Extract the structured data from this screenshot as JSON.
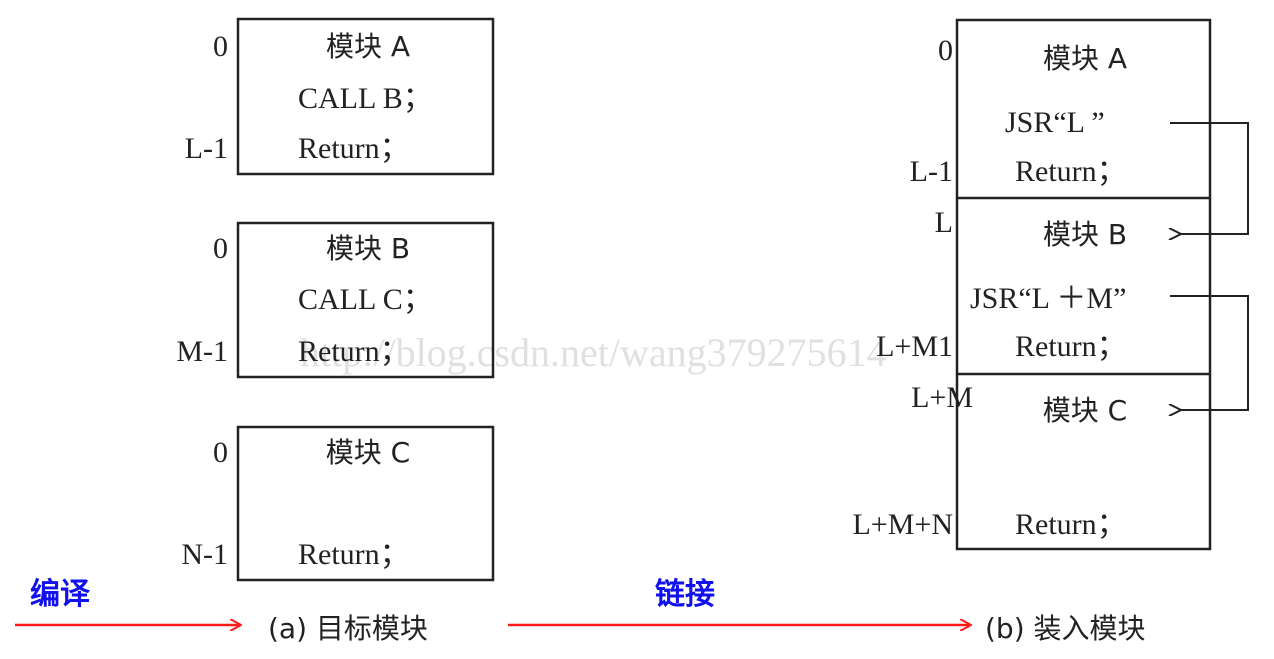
{
  "left": {
    "module_a": {
      "start": "0",
      "end": "L-1",
      "title": "模块 A",
      "line2": "CALL B；",
      "line3": "Return；"
    },
    "module_b": {
      "start": "0",
      "end": "M-1",
      "title": "模块 B",
      "line2": "CALL C；",
      "line3": "Return；"
    },
    "module_c": {
      "start": "0",
      "end": "N-1",
      "title": "模块 C",
      "line3": "Return；"
    },
    "caption": "(a) 目标模块"
  },
  "right": {
    "addr_0": "0",
    "addr_l_minus_1": "L-1",
    "addr_l": "L",
    "addr_lm1": "L+M1",
    "addr_lm": "L+M",
    "addr_lmn": "L+M+N",
    "seg_a": {
      "title": "模块 A",
      "jsr": "JSR“L ”",
      "ret": "Return；"
    },
    "seg_b": {
      "title": "模块 B",
      "jsr": "JSR“L ＋M”",
      "ret": "Return；"
    },
    "seg_c": {
      "title": "模块 C",
      "ret": "Return；"
    },
    "caption": "(b) 装入模块"
  },
  "arrows": {
    "compile_label": "编译",
    "link_label": "链接",
    "color": "#ff1a1a",
    "label_color": "#1111ee"
  },
  "watermark": "http://blog.csdn.net/wang379275614"
}
